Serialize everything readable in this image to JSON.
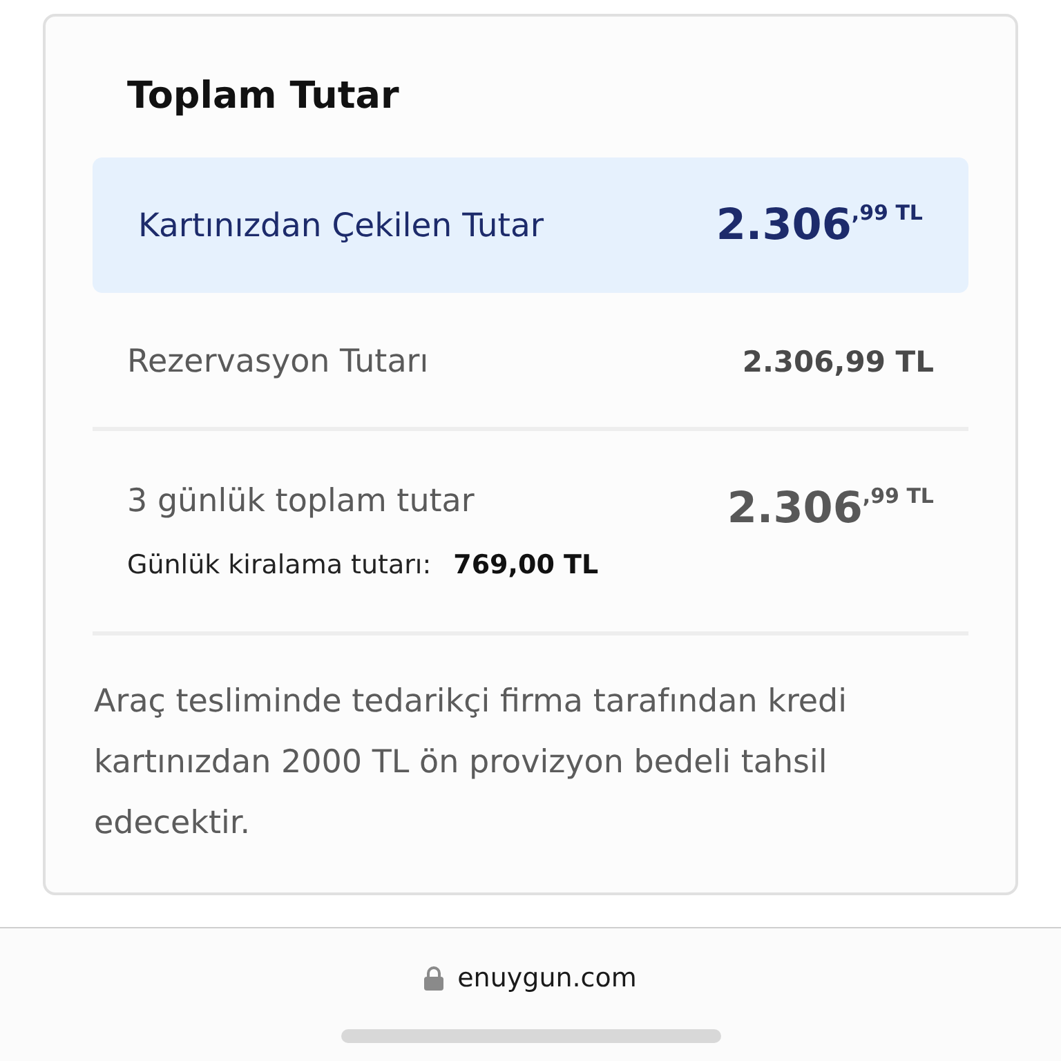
{
  "title": "Toplam Tutar",
  "charged": {
    "label": "Kartınızdan Çekilen Tutar",
    "amount": "2.306$^{,99 TL}$"
  },
  "rows": [
    {
      "kind": "plain",
      "label": "Rezervasyon Tutarı",
      "value": "2.306,99 TL"
    },
    {
      "kind": "detailed",
      "label": "3 günlük toplam tutar",
      "value": "2.306$^{,99 TL}$",
      "sub_label": "Günlük kiralama tutarı:",
      "sub_value": "769,00 TL"
    }
  ],
  "note": "Araç tesliminde tedarikçi firma tarafından kredi kartınızdan 2000 TL ön provizyon bedeli tahsil edecektir.",
  "browser_bar": {
    "url": "enuygun.com"
  }
}
